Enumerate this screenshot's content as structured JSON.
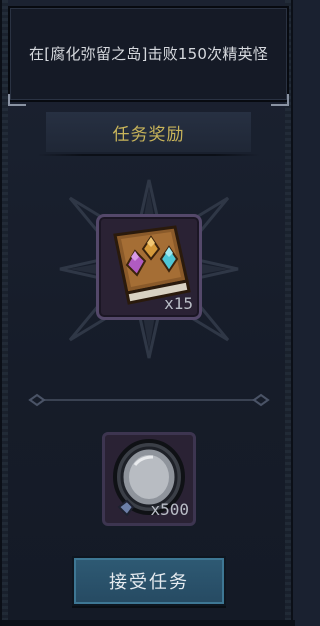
{
  "quest": {
    "description": "在[腐化弥留之岛]击败150次精英怪"
  },
  "rewards": {
    "header": "任务奖励",
    "items": [
      {
        "icon": "gem-book-icon",
        "quantity": "x15"
      },
      {
        "icon": "silver-coin-icon",
        "quantity": "x500"
      }
    ]
  },
  "actions": {
    "accept_label": "接受任务"
  },
  "colors": {
    "header_text": "#c8b45a",
    "button_bg": "#2e5a74",
    "slot_border": "#54486a"
  }
}
